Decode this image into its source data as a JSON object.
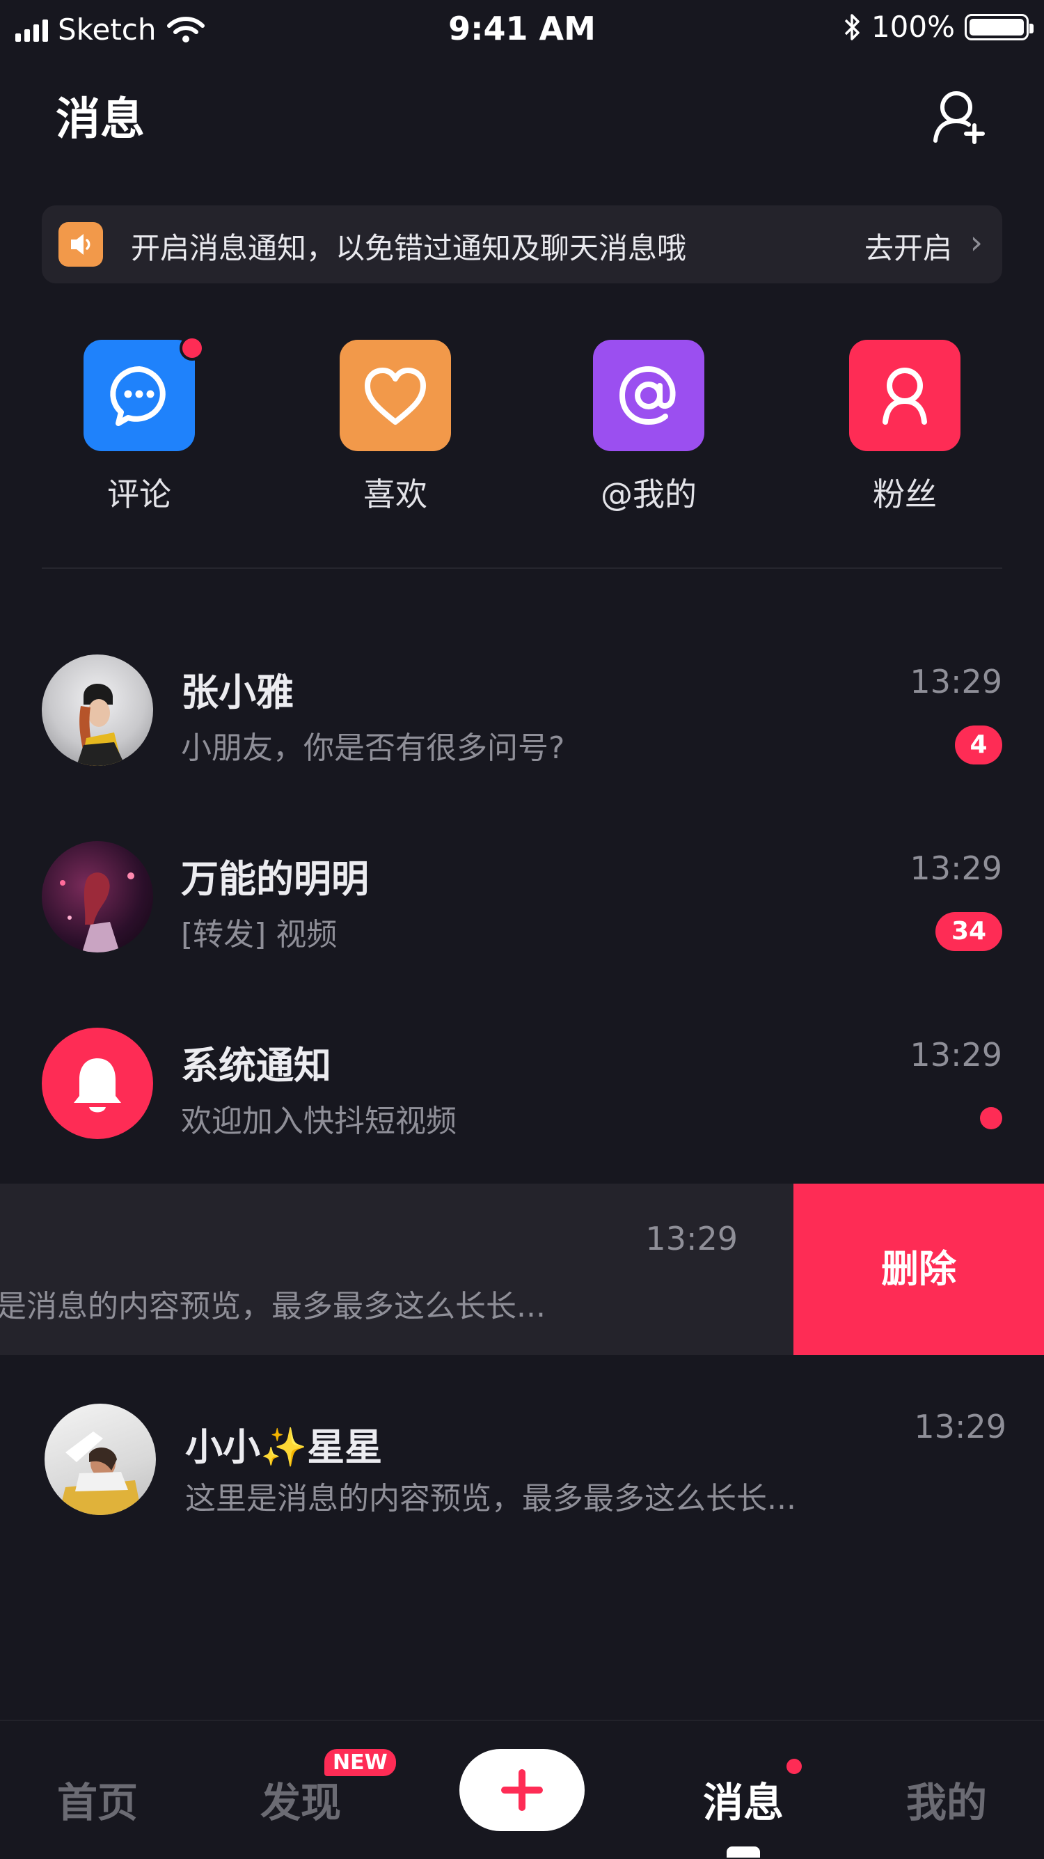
{
  "status_bar": {
    "carrier": "Sketch",
    "time": "9:41 AM",
    "battery": "100%"
  },
  "header": {
    "title": "消息"
  },
  "notice": {
    "text": "开启消息通知，以免错过通知及聊天消息哦",
    "action": "去开启"
  },
  "shortcuts": [
    {
      "label": "评论",
      "color": "#1f82fb",
      "has_dot": true
    },
    {
      "label": "喜欢",
      "color": "#f2994a"
    },
    {
      "label": "@我的",
      "color": "#9b4ff0"
    },
    {
      "label": "粉丝",
      "color": "#fe2c55"
    }
  ],
  "messages": [
    {
      "name": "张小雅",
      "preview": "小朋友，你是否有很多问号?",
      "time": "13:29",
      "badge": "4"
    },
    {
      "name": "万能的明明",
      "preview": "[转发] 视频",
      "time": "13:29",
      "badge": "34"
    },
    {
      "name": "系统通知",
      "preview": "欢迎加入快抖短视频",
      "time": "13:29",
      "unread_dot": true
    },
    {
      "preview": "是消息的内容预览，最多最多这么长长...",
      "time": "13:29",
      "action": "删除"
    },
    {
      "name": "小小✨星星",
      "preview": "这里是消息的内容预览，最多最多这么长长...",
      "time": "13:29"
    }
  ],
  "tabbar": {
    "home": "首页",
    "discover": "发现",
    "discover_badge": "NEW",
    "messages": "消息",
    "me": "我的"
  },
  "colors": {
    "accent": "#fe2c55",
    "background": "#17171f"
  }
}
